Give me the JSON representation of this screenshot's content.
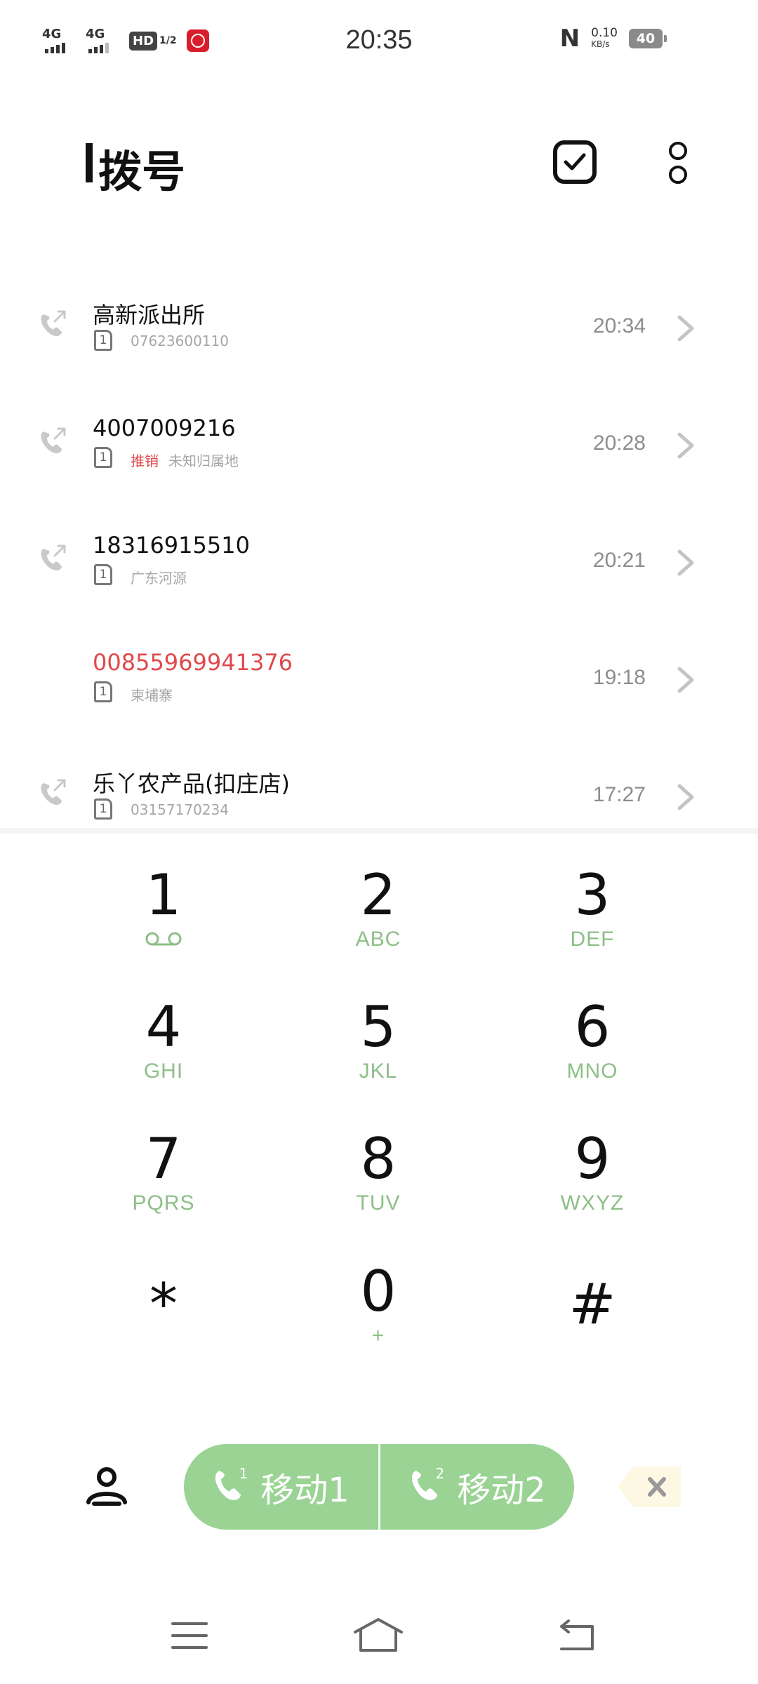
{
  "status_bar": {
    "network1": "4G",
    "network2": "4G",
    "hd_label": "HD",
    "hd_sim": "1/2",
    "time": "20:35",
    "speed_value": "0.10",
    "speed_unit": "KB/s",
    "battery": "40"
  },
  "header": {
    "title": "拨号",
    "select_icon": "check-square-icon",
    "more_icon": "more-vertical-icon"
  },
  "call_log": [
    {
      "name": "高新派出所",
      "sim": "1",
      "tag": "",
      "detail": "07623600110",
      "time": "20:34",
      "missed": false,
      "icon": "outgoing-call-icon"
    },
    {
      "name": "4007009216",
      "sim": "1",
      "tag": "推销",
      "detail": "未知归属地",
      "time": "20:28",
      "missed": false,
      "icon": "outgoing-call-icon"
    },
    {
      "name": "18316915510",
      "sim": "1",
      "tag": "",
      "detail": "广东河源",
      "time": "20:21",
      "missed": false,
      "icon": "outgoing-call-icon"
    },
    {
      "name": "00855969941376",
      "sim": "1",
      "tag": "",
      "detail": "柬埔寨",
      "time": "19:18",
      "missed": true,
      "icon": ""
    },
    {
      "name": "乐丫农产品(扣庄店)",
      "sim": "1",
      "tag": "",
      "detail": "03157170234",
      "time": "17:27",
      "missed": false,
      "icon": "outgoing-call-icon"
    }
  ],
  "keypad": [
    {
      "digit": "1",
      "letters": ""
    },
    {
      "digit": "2",
      "letters": "ABC"
    },
    {
      "digit": "3",
      "letters": "DEF"
    },
    {
      "digit": "4",
      "letters": "GHI"
    },
    {
      "digit": "5",
      "letters": "JKL"
    },
    {
      "digit": "6",
      "letters": "MNO"
    },
    {
      "digit": "7",
      "letters": "PQRS"
    },
    {
      "digit": "8",
      "letters": "TUV"
    },
    {
      "digit": "9",
      "letters": "WXYZ"
    },
    {
      "digit": "*",
      "letters": ""
    },
    {
      "digit": "0",
      "letters": "+"
    },
    {
      "digit": "#",
      "letters": ""
    }
  ],
  "actions": {
    "dial_sim1_label": "移动1",
    "dial_sim1_index": "1",
    "dial_sim2_label": "移动2",
    "dial_sim2_index": "2",
    "dial_color": "#9ad394",
    "delete_color": "#fdf8e3"
  },
  "colors": {
    "accent_green": "#8dbf87",
    "missed_red": "#e0494b",
    "muted_text": "#a6a6a6"
  }
}
